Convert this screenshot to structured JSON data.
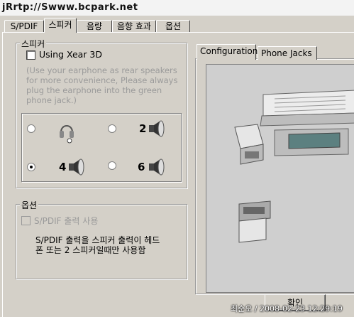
{
  "watermark": "jRrtp://Swww.bcpark.net",
  "tabs": [
    {
      "label": "S/PDIF"
    },
    {
      "label": "스피커"
    },
    {
      "label": "음량"
    },
    {
      "label": "음향 효과"
    },
    {
      "label": "옵션"
    }
  ],
  "speaker_group": {
    "legend": "스피커",
    "xear_checkbox_label": "Using Xear 3D",
    "xear_note": "(Use your earphone as rear speakers for more convenience, Please always plug the earphone into the green phone jack.)",
    "note_lines": [
      "(Use your earphone as rear speakers",
      "for more convenience, Please always",
      "plug the earphone into the green",
      "phone jack.)"
    ],
    "options": [
      {
        "label": "",
        "selected": false,
        "icon": "headphone-icon"
      },
      {
        "label": "2",
        "selected": false,
        "icon": "speaker-icon"
      },
      {
        "label": "4",
        "selected": true,
        "icon": "speaker-icon"
      },
      {
        "label": "6",
        "selected": false,
        "icon": "speaker-icon"
      }
    ]
  },
  "option_group": {
    "legend": "옵션",
    "spdif_checkbox_label": "S/PDIF 출력 사용",
    "desc_lines": [
      "S/PDIF 출력을 스피커 출력이 헤드",
      "폰 또는 2 스피커일때만 사용함"
    ]
  },
  "right_tabs": [
    {
      "label": "Configuration"
    },
    {
      "label": "Phone Jacks"
    }
  ],
  "ok_button": "확인",
  "stamp": "최순오 / 2008-02-23 12:29:19"
}
